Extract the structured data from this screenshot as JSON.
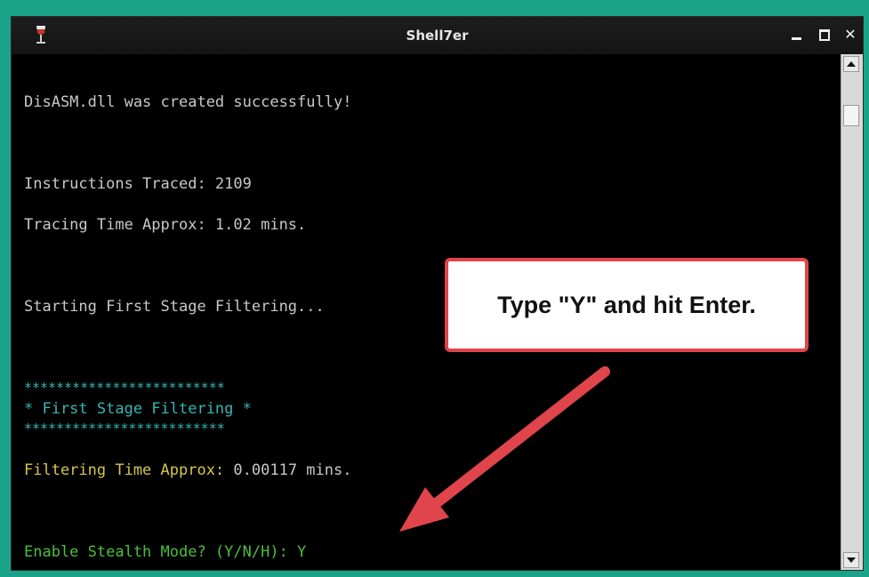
{
  "window": {
    "title": "Shell7er",
    "buttons": {
      "minimize": "minimize",
      "maximize": "maximize",
      "close": "close"
    },
    "icon": "wine-glass-icon"
  },
  "terminal": {
    "lines": [
      {
        "text": "DisASM.dll was created successfully!",
        "color": "#c8c8c8"
      },
      {
        "text": "Instructions Traced: 2109",
        "color": "#c8c8c8"
      },
      {
        "text": "Tracing Time Approx: 1.02 mins.",
        "color": "#c8c8c8"
      },
      {
        "text": "Starting First Stage Filtering...",
        "color": "#c8c8c8"
      },
      {
        "text": "*************************",
        "color": "#35b6b4"
      },
      {
        "text": "* First Stage Filtering *",
        "color": "#35b6b4"
      },
      {
        "text": "*************************",
        "color": "#35b6b4"
      },
      {
        "label": "Filtering Time Approx:",
        "value": " 0.00117 mins.",
        "label_color": "#d6c64a",
        "value_color": "#c8c8c8"
      },
      {
        "text": "Enable Stealth Mode? (Y/N/H): Y",
        "color": "#4cbf3a"
      }
    ]
  },
  "annotation": {
    "callout_text": "Type \"Y\" and hit Enter.",
    "border_color": "#e0454b",
    "arrow_color": "#e0454b"
  }
}
